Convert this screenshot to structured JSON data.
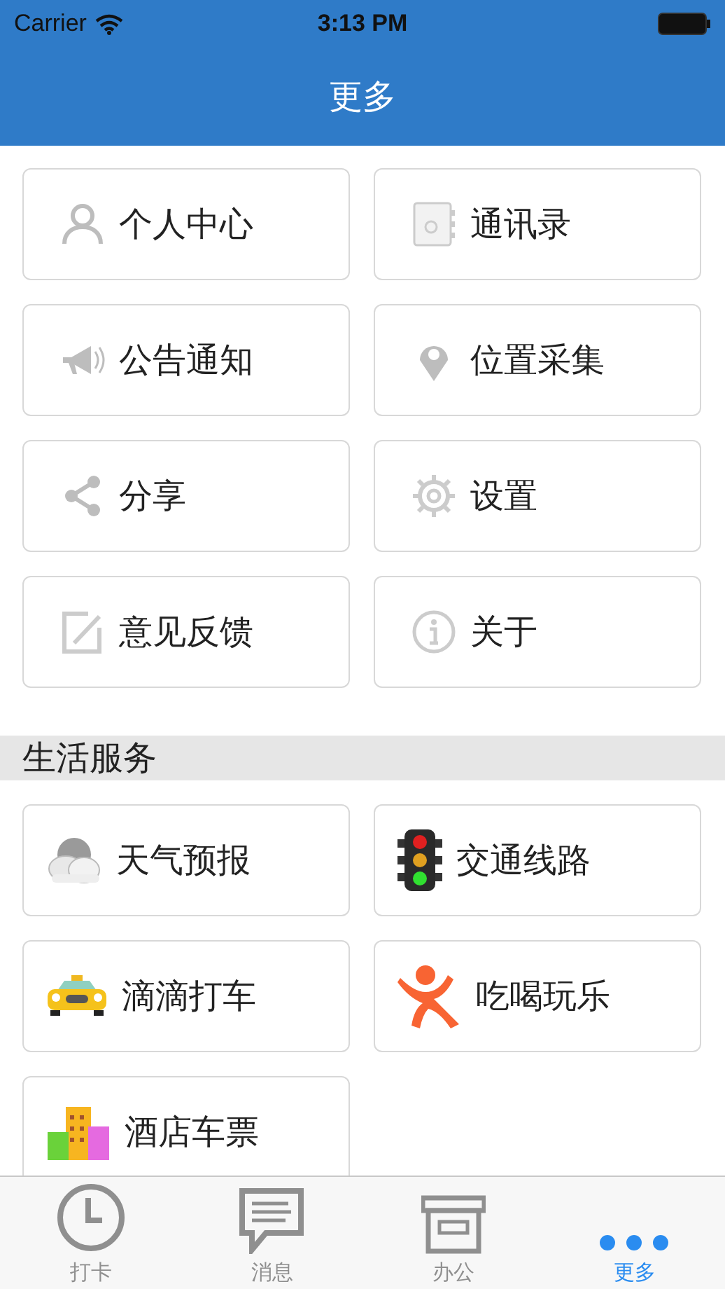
{
  "status_bar": {
    "carrier": "Carrier",
    "time": "3:13 PM"
  },
  "nav_bar": {
    "title": "更多"
  },
  "menu_items": [
    {
      "label": "个人中心",
      "kind": "person"
    },
    {
      "label": "通讯录",
      "kind": "addressbook"
    },
    {
      "label": "公告通知",
      "kind": "megaphone"
    },
    {
      "label": "位置采集",
      "kind": "pin"
    },
    {
      "label": "分享",
      "kind": "share"
    },
    {
      "label": "设置",
      "kind": "gear"
    },
    {
      "label": "意见反馈",
      "kind": "edit"
    },
    {
      "label": "关于",
      "kind": "info"
    }
  ],
  "section": {
    "title": "生活服务"
  },
  "service_items": [
    {
      "label": "天气预报",
      "kind": "cloud"
    },
    {
      "label": "交通线路",
      "kind": "traffic"
    },
    {
      "label": "滴滴打车",
      "kind": "taxi"
    },
    {
      "label": "吃喝玩乐",
      "kind": "figure"
    },
    {
      "label": "酒店车票",
      "kind": "buildings"
    }
  ],
  "tab_bar": [
    {
      "label": "打卡",
      "kind": "clock",
      "selected": false
    },
    {
      "label": "消息",
      "kind": "chat",
      "selected": false
    },
    {
      "label": "办公",
      "kind": "box",
      "selected": false
    },
    {
      "label": "更多",
      "kind": "dots",
      "selected": true
    }
  ]
}
